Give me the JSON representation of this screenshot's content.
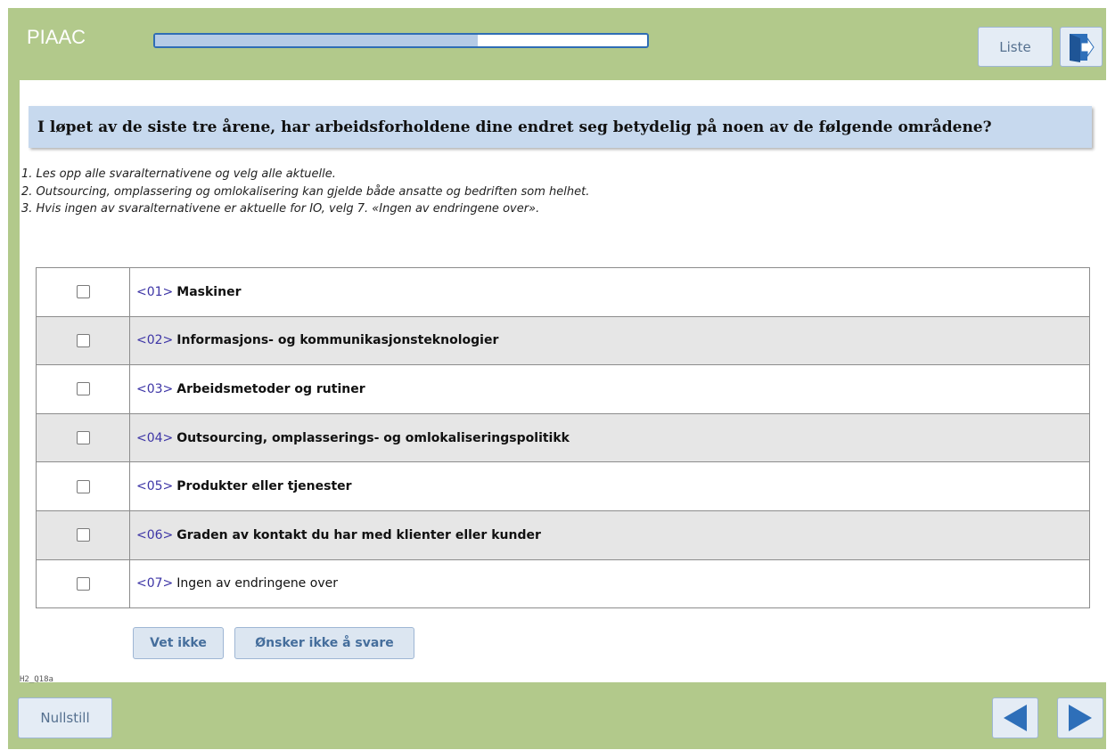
{
  "app": {
    "title": "PIAAC"
  },
  "progress": {
    "fraction": 0.655
  },
  "header": {
    "list_label": "Liste",
    "exit_icon": "exit-door-icon"
  },
  "question": {
    "text": "I løpet av de siste tre årene, har arbeidsforholdene dine endret seg betydelig på noen av de følgende områdene?",
    "instructions": [
      "1. Les opp alle svaralternativene og velg alle aktuelle.",
      "2. Outsourcing, omplassering og omlokalisering kan gjelde både ansatte og bedriften som helhet.",
      "3. Hvis ingen av svaralternativene er aktuelle for IO, velg 7. «Ingen av endringene over»."
    ]
  },
  "options": [
    {
      "code": "<01>",
      "label": "Maskiner",
      "checked": false
    },
    {
      "code": "<02>",
      "label": "Informasjons- og kommunikasjonsteknologier",
      "checked": false
    },
    {
      "code": "<03>",
      "label": "Arbeidsmetoder og rutiner",
      "checked": false
    },
    {
      "code": "<04>",
      "label": "Outsourcing, omplasserings- og omlokaliseringspolitikk",
      "checked": false
    },
    {
      "code": "<05>",
      "label": "Produkter eller tjenester",
      "checked": false
    },
    {
      "code": "<06>",
      "label": "Graden av kontakt du har med klienter eller kunder",
      "checked": false
    },
    {
      "code": "<07>",
      "label": "Ingen av endringene over",
      "checked": false
    }
  ],
  "extra_buttons": {
    "dont_know": "Vet ikke",
    "refuse": "Ønsker ikke å svare"
  },
  "question_id": "H2_Q18a",
  "footer": {
    "reset_label": "Nullstill",
    "prev_icon": "arrow-left-icon",
    "next_icon": "arrow-right-icon"
  },
  "colors": {
    "frame": "#b2c98b",
    "question_bg": "#c7d9ee",
    "progress_border": "#2f6db5",
    "nav_arrow": "#2e6fb9"
  }
}
